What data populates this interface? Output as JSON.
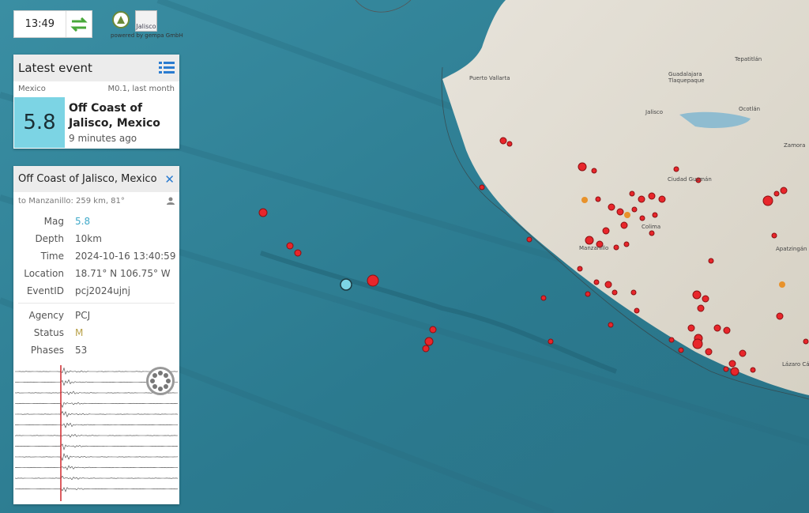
{
  "topbar": {
    "time": "13:49",
    "logo_text": "Jalisco",
    "powered": "powered by gempa GmbH"
  },
  "latest": {
    "title": "Latest event",
    "region_country": "Mexico",
    "filter": "M0.1, last month",
    "mag": "5.8",
    "region": "Off Coast of Jalisco, Mexico",
    "ago": "9 minutes ago",
    "mag_color": "#7cd4e4"
  },
  "detail": {
    "title": "Off Coast of Jalisco, Mexico",
    "distance": "to Manzanillo: 259 km, 81°",
    "fields": [
      {
        "k": "Mag",
        "v": "5.8"
      },
      {
        "k": "Depth",
        "v": "10km"
      },
      {
        "k": "Time",
        "v": "2024-10-16 13:40:59"
      },
      {
        "k": "Location",
        "v": "18.71° N 106.75° W"
      },
      {
        "k": "EventID",
        "v": "pcj2024ujnj"
      }
    ],
    "fields2": [
      {
        "k": "Agency",
        "v": "PCJ"
      },
      {
        "k": "Status",
        "v": "M"
      },
      {
        "k": "Phases",
        "v": "53"
      }
    ]
  },
  "map": {
    "labels": [
      "Puerto Vallarta",
      "Guadalajara",
      "Tlaquepaque",
      "Tepatitlán",
      "Ocotlán",
      "Jalisco",
      "Zamora",
      "Ciudad Guzmán",
      "Colima",
      "Manzanillo",
      "Apatzingán",
      "Lázaro Cárdenas"
    ],
    "event_color": "#e8262b",
    "selected_color": "#7cd4e4"
  }
}
